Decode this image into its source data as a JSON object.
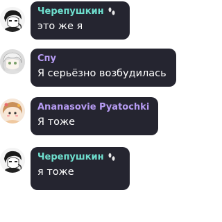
{
  "messages": [
    {
      "author": "Черепушкин",
      "text": "это же я",
      "author_color": "#6fe0cf",
      "has_badge": true,
      "badge_icon": "footprints-icon"
    },
    {
      "author": "Спу",
      "text": "Я серьёзно возбудилась",
      "author_color": "#b79cf4",
      "has_badge": false
    },
    {
      "author": "Ananasovie Pyatochki",
      "text": "Я тоже",
      "author_color": "#b79cf4",
      "has_badge": false
    },
    {
      "author": "Черепушкин",
      "text": "я тоже",
      "author_color": "#6fe0cf",
      "has_badge": true,
      "badge_icon": "footprints-icon"
    }
  ]
}
